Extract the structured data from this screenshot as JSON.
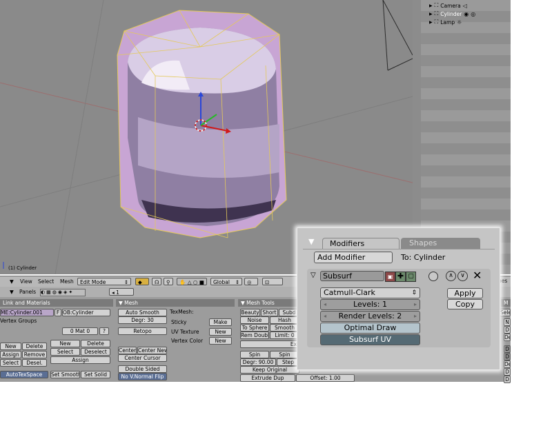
{
  "viewport": {
    "label": "(1) Cylinder"
  },
  "outliner": {
    "items": [
      "Camera",
      "Cylinder",
      "Lamp"
    ]
  },
  "header": {
    "menus": [
      "View",
      "Select",
      "Mesh"
    ],
    "mode": "Edit Mode",
    "orientation": "Global",
    "panels_label": "Panels",
    "frame": "1"
  },
  "link_materials": {
    "title": "Link and Materials",
    "me_field": "ME:Cylinder.001",
    "f_label": "F",
    "ob_field": "OB:Cylinder",
    "vertex_groups": "Vertex Groups",
    "mat_field": "0 Mat 0",
    "question": "?",
    "buttons_left": [
      "New",
      "Delete",
      "Assign",
      "Remove",
      "Select",
      "Desel."
    ],
    "buttons_right": [
      "New",
      "Delete",
      "Select",
      "Deselect",
      "Assign"
    ],
    "autotex": "AutoTexSpace",
    "set_smooth": "Set Smooth",
    "set_solid": "Set Solid"
  },
  "mesh_panel": {
    "title": "Mesh",
    "auto_smooth": "Auto Smooth",
    "degr": "Degr: 30",
    "retopo": "Retopo",
    "center": "Center",
    "center_new": "Center New",
    "center_cursor": "Center Cursor",
    "double_sided": "Double Sided",
    "no_vnormal": "No V.Normal Flip",
    "texmesh": "TexMesh:",
    "sticky": "Sticky",
    "make": "Make",
    "uv_texture": "UV Texture",
    "new1": "New",
    "vertex_color": "Vertex Color",
    "new2": "New"
  },
  "mesh_tools": {
    "title": "Mesh Tools",
    "beauty": "Beauty",
    "short": "Short",
    "subd": "Subd",
    "noise": "Noise",
    "hash": "Hash",
    "to_sphere": "To Sphere",
    "smooth": "Smooth",
    "rem_doubl": "Rem Doubl",
    "limit": "Limit: 0",
    "extr": "Ext",
    "spin": "Spin",
    "spin2": "Spin",
    "degr": "Degr: 90.00",
    "step": "Step",
    "keep_original": "Keep Original",
    "extrude_dup": "Extrude Dup",
    "offset": "Offset: 1.00"
  },
  "right_strip": {
    "text": "nes",
    "m": "M",
    "sele": "Sele",
    "items": [
      "N",
      "D",
      "De",
      "D",
      "D",
      "De",
      "D",
      "D"
    ]
  },
  "modifier_panel": {
    "tab_modifiers": "Modifiers",
    "tab_shapes": "Shapes",
    "add_modifier": "Add Modifier",
    "to_label": "To: Cylinder",
    "modifier_name": "Subsurf",
    "apply": "Apply",
    "copy": "Copy",
    "subdiv_type": "Catmull-Clark",
    "levels": "Levels: 1",
    "render_levels": "Render Levels: 2",
    "optimal_draw": "Optimal Draw",
    "subsurf_uv": "Subsurf UV"
  },
  "colors": {
    "viewport_bg": "#8a8a8a",
    "mesh_fill": "#c8a5d4",
    "cage": "#e4c95a",
    "active_toggle": "#5a6e94"
  }
}
